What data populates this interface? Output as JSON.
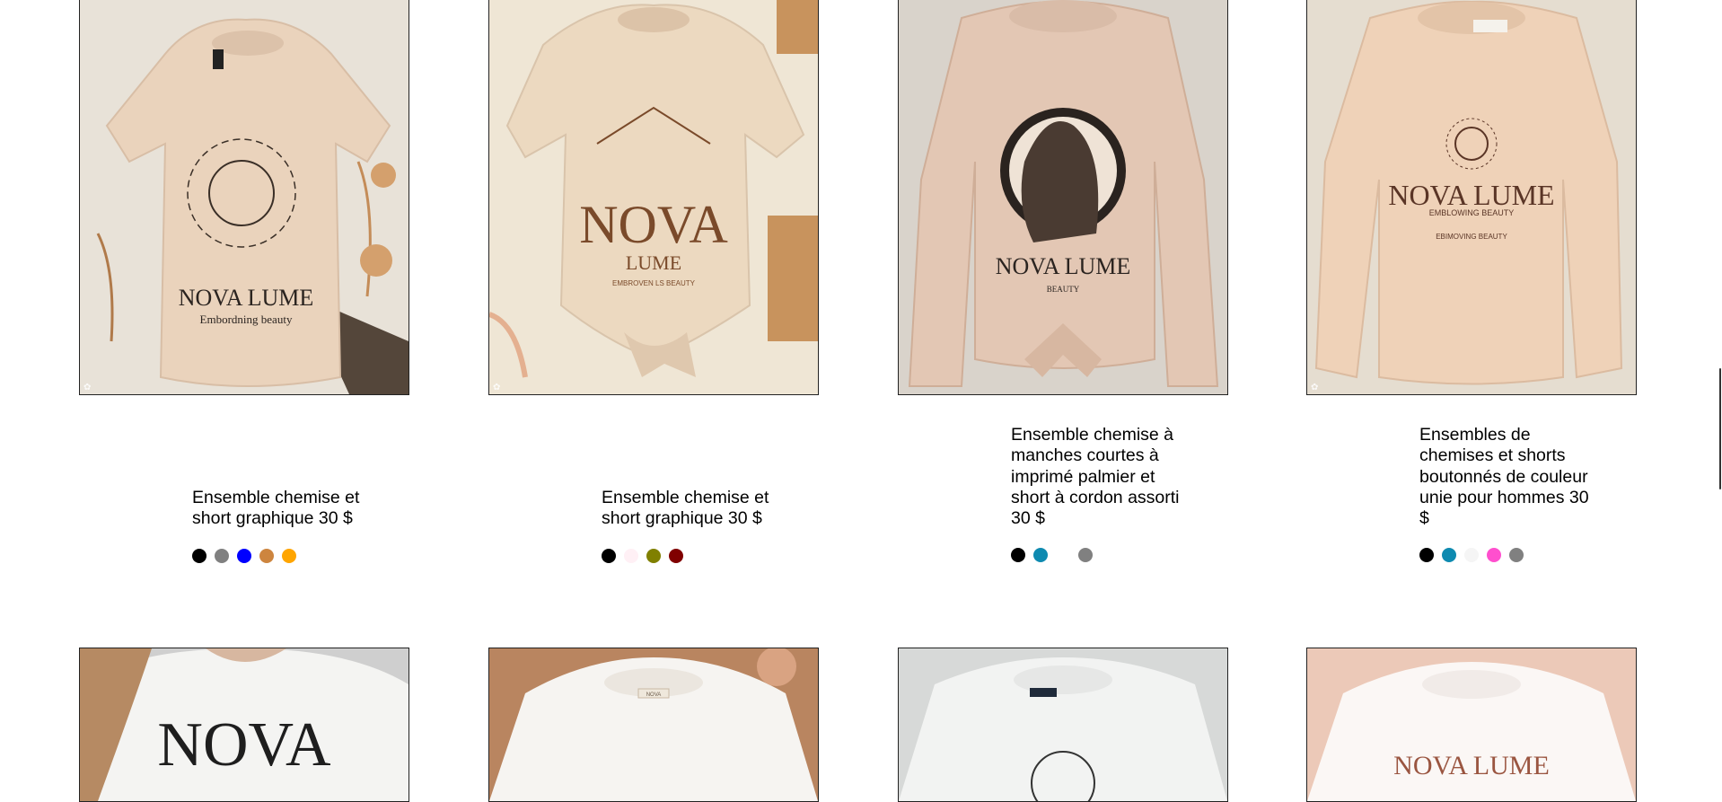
{
  "products": [
    {
      "title": "Ensemble chemise et short graphique 30 $",
      "image": {
        "bg": "#e8e2d8",
        "shirt": "#ead3bc",
        "brand": "NOVA LUME",
        "tagline": "Embordning beauty",
        "sleeve": "short"
      },
      "swatches": [
        "#000000",
        "#808080",
        "#0000ff",
        "#cd853f",
        "#ffa500"
      ]
    },
    {
      "title": "Ensemble chemise et short graphique 30 $",
      "image": {
        "bg": "#efe6d5",
        "shirt": "#ecd9c0",
        "brand": "NOVA",
        "brand2": "LUME",
        "tagline": "EMBROVEN LS BEAUTY",
        "sleeve": "short"
      },
      "swatches": [
        "#000000",
        "#fff0f5",
        "#808000",
        "#800000"
      ]
    },
    {
      "title": "Ensemble chemise à manches courtes à imprimé palmier et short à cordon assorti 30 $",
      "image": {
        "bg": "#d9d3cb",
        "shirt": "#e3c7b4",
        "brand": "NOVA LUME",
        "tagline": "BEAUTY",
        "sleeve": "long"
      },
      "swatches": [
        "#000000",
        "#0e8ab0",
        "#ffffff",
        "#808080"
      ]
    },
    {
      "title": "Ensembles de chemises et shorts boutonnés de couleur unie pour hommes 30 $",
      "image": {
        "bg": "#e5ddd0",
        "shirt": "#efd2b8",
        "brand": "NOVA LUME",
        "tagline": "EMBLOWING BEAUTY",
        "tagline2": "EBIMOVING BEAUTY",
        "sleeve": "long"
      },
      "swatches": [
        "#000000",
        "#0e8ab0",
        "#f5f5f5",
        "#ff4fce",
        "#808080"
      ]
    },
    {
      "title": "",
      "image": {
        "bg": "#cfcfcf",
        "shirt": "#f4f4f2",
        "brand": "NOVA",
        "sleeve": "model"
      },
      "swatches": []
    },
    {
      "title": "",
      "image": {
        "bg": "#b98560",
        "shirt": "#f6f4f1",
        "label": "NOVA",
        "sleeve": "flat"
      },
      "swatches": []
    },
    {
      "title": "",
      "image": {
        "bg": "#d7d9d8",
        "shirt": "#f2f3f2",
        "sleeve": "flat"
      },
      "swatches": []
    },
    {
      "title": "",
      "image": {
        "bg": "#ecc9b8",
        "shirt": "#fbf7f5",
        "brand": "NOVA LUME",
        "sleeve": "flat"
      },
      "swatches": []
    }
  ]
}
